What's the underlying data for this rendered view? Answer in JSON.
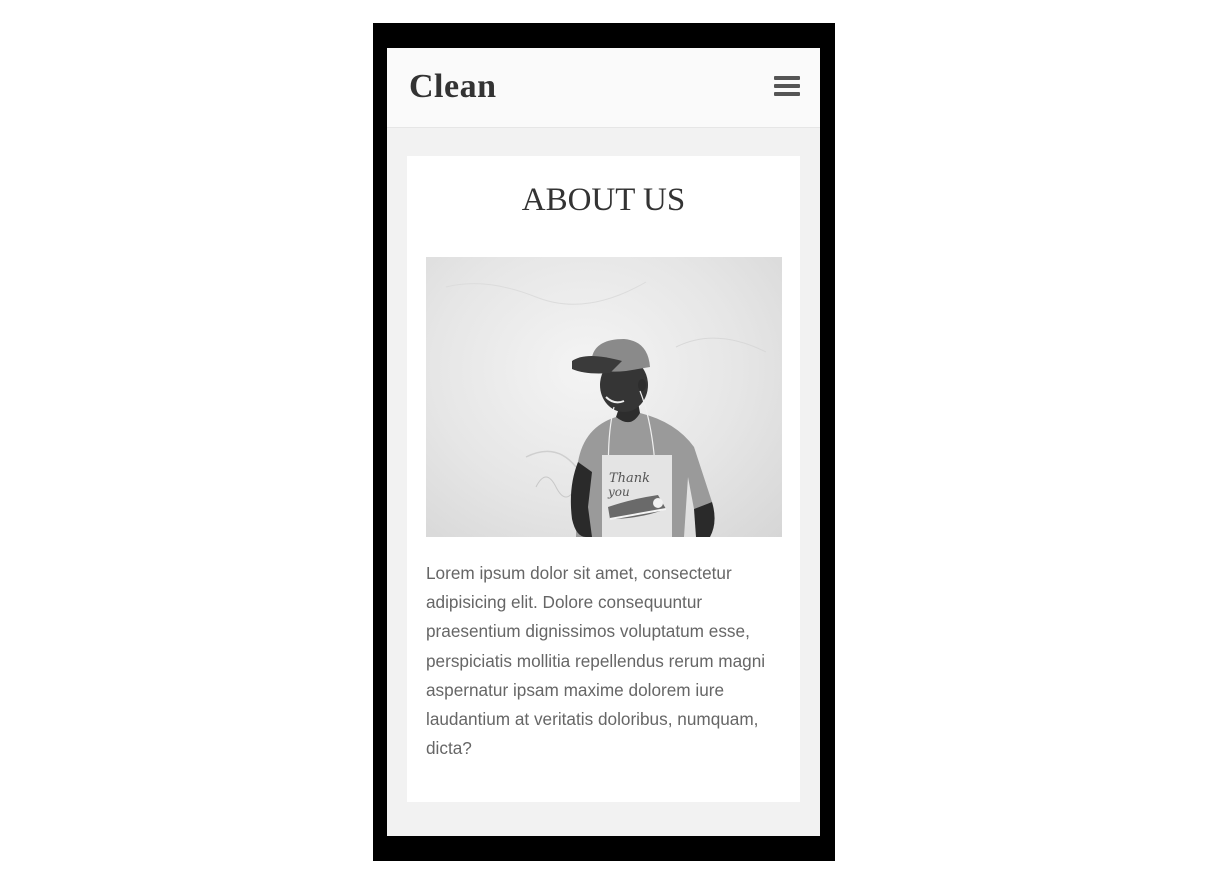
{
  "navbar": {
    "brand": "Clean",
    "menu_icon": "hamburger-menu-icon"
  },
  "about": {
    "title": "ABOUT US",
    "photo": {
      "alt": "Black and white photo of a smiling young man wearing a cap and a t-shirt printed with \"Thank you\" and a sneaker",
      "shirt_text_line1": "Thank",
      "shirt_text_line2": "you"
    },
    "body": "Lorem ipsum dolor sit amet, consectetur adipisicing elit. Dolore consequuntur praesentium dignissimos voluptatum esse, perspiciatis mollitia repellendus rerum magni aspernatur ipsam maxime dolorem iure laudantium at veritatis doloribus, numquam, dicta?"
  },
  "colors": {
    "frame": "#000000",
    "page_background": "#f2f2f2",
    "navbar_background": "#fafafa",
    "card_background": "#ffffff",
    "heading": "#333333",
    "body_text": "#666666"
  }
}
